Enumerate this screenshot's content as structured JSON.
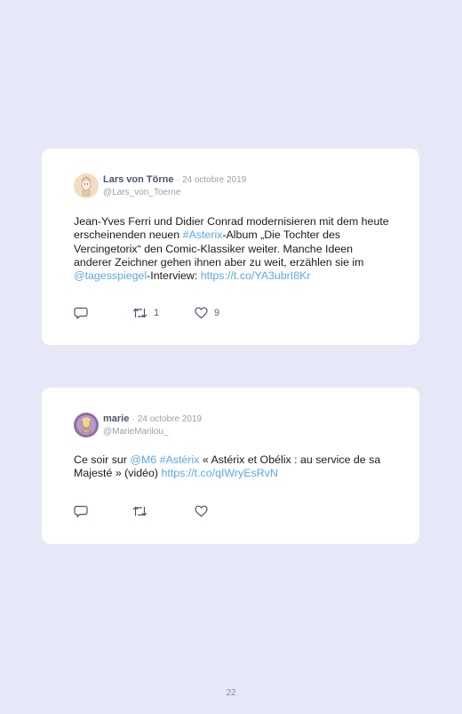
{
  "tweets": [
    {
      "name": "Lars von Törne",
      "separator": "·",
      "date": "24 octobre 2019",
      "handle": "@Lars_von_Toerne",
      "text": {
        "t1": "Jean-Yves Ferri und Didier Conrad modernisieren mit dem heute erscheinenden neuen ",
        "hashtag": "#Asterix",
        "t2": "-Album „Die Tochter des Vercingetorix“ den Comic-Klassiker weiter. Manche Ideen anderer Zeichner gehen ihnen aber zu weit, erzählen sie im ",
        "mention": "@tagesspiegel",
        "t3": "-Interview: ",
        "url": "https://t.co/YA3ubrI8Kr"
      },
      "retweets": "1",
      "likes": "9",
      "icons": {
        "reply": "reply-icon",
        "retweet": "retweet-icon",
        "like": "heart-icon"
      }
    },
    {
      "name": "marie",
      "separator": "·",
      "date": "24 octobre 2019",
      "handle": "@MarieMarilou_",
      "text": {
        "t1": "Ce soir sur ",
        "mention": "@M6",
        "t2": " ",
        "hashtag": "#Astérix",
        "t3": " « Astérix et Obélix : au service de sa Majesté » (vidéo) ",
        "url": "https://t.co/qIWryEsRvN"
      },
      "retweets": "",
      "likes": "",
      "icons": {
        "reply": "reply-icon",
        "retweet": "retweet-icon",
        "like": "heart-icon"
      }
    }
  ],
  "colors": {
    "background": "#e7e8f7",
    "card": "#ffffff",
    "link": "#5aa9e6",
    "name": "#4a5568",
    "meta": "#9aa0a8"
  },
  "page_number": "22"
}
